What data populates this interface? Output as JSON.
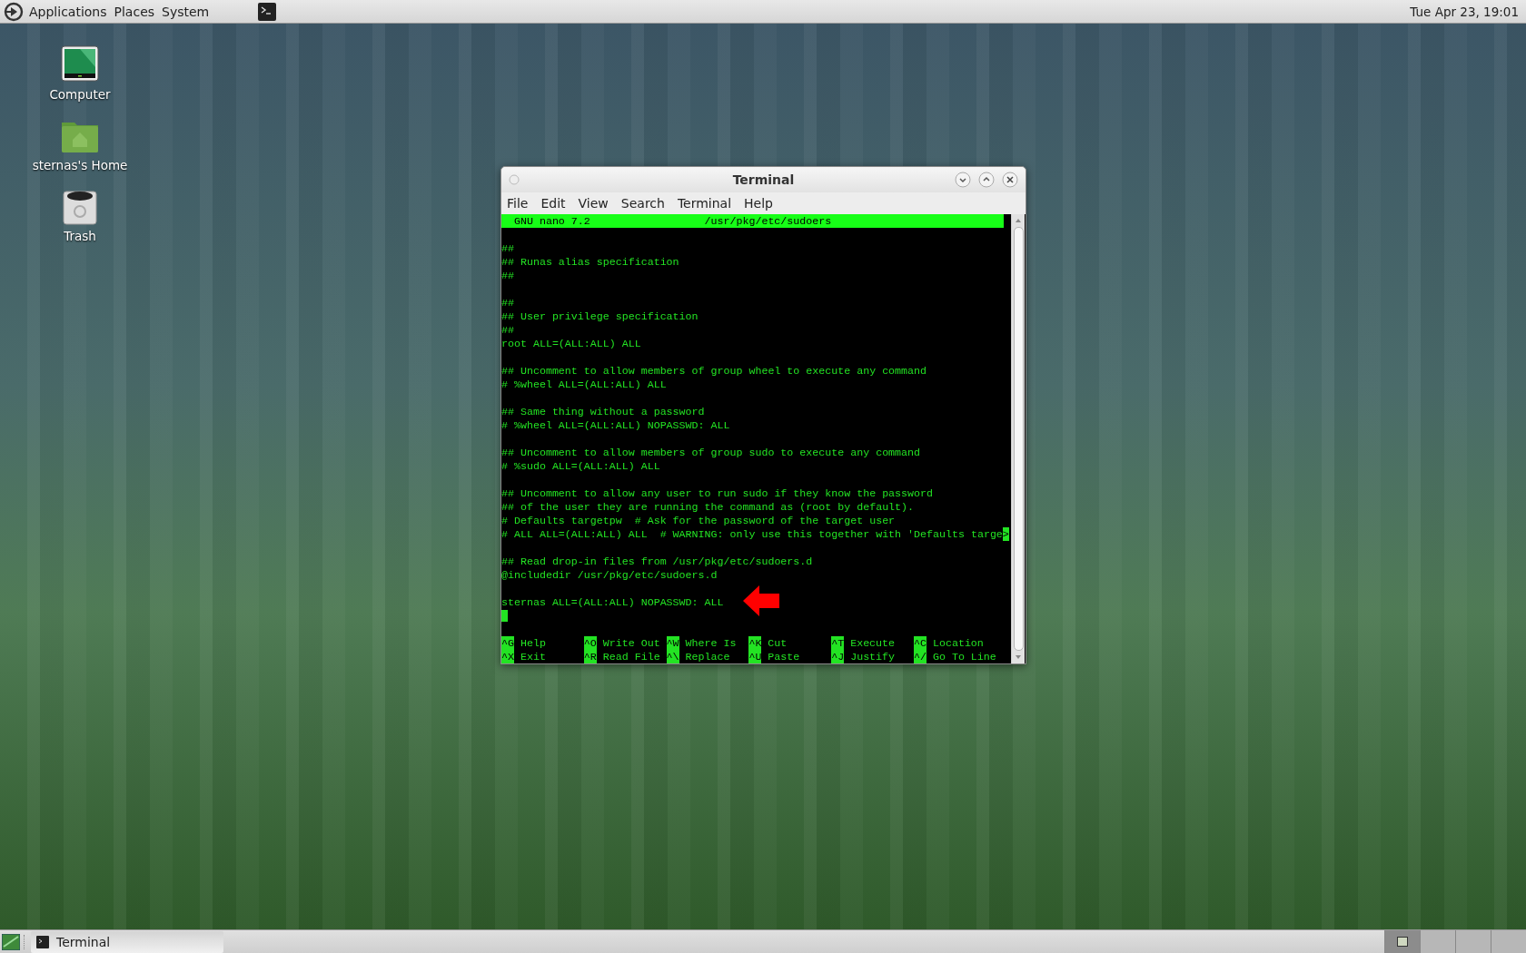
{
  "top_panel": {
    "menus": [
      "Applications",
      "Places",
      "System"
    ],
    "clock": "Tue Apr 23, 19:01"
  },
  "desktop_icons": [
    {
      "kind": "computer",
      "label": "Computer"
    },
    {
      "kind": "home",
      "label": "sternas's Home"
    },
    {
      "kind": "trash",
      "label": "Trash"
    }
  ],
  "window": {
    "title": "Terminal",
    "menu": [
      "File",
      "Edit",
      "View",
      "Search",
      "Terminal",
      "Help"
    ],
    "nano": {
      "version": "GNU nano 7.2",
      "file": "/usr/pkg/etc/sudoers",
      "lines": [
        {
          "kind": "blank"
        },
        {
          "kind": "text",
          "text": "##"
        },
        {
          "kind": "text",
          "text": "## Runas alias specification"
        },
        {
          "kind": "text",
          "text": "##"
        },
        {
          "kind": "blank"
        },
        {
          "kind": "text",
          "text": "##"
        },
        {
          "kind": "text",
          "text": "## User privilege specification"
        },
        {
          "kind": "text",
          "text": "##"
        },
        {
          "kind": "text",
          "text": "root ALL=(ALL:ALL) ALL"
        },
        {
          "kind": "blank"
        },
        {
          "kind": "text",
          "text": "## Uncomment to allow members of group wheel to execute any command"
        },
        {
          "kind": "text",
          "text": "# %wheel ALL=(ALL:ALL) ALL"
        },
        {
          "kind": "blank"
        },
        {
          "kind": "text",
          "text": "## Same thing without a password"
        },
        {
          "kind": "text",
          "text": "# %wheel ALL=(ALL:ALL) NOPASSWD: ALL"
        },
        {
          "kind": "blank"
        },
        {
          "kind": "text",
          "text": "## Uncomment to allow members of group sudo to execute any command"
        },
        {
          "kind": "text",
          "text": "# %sudo ALL=(ALL:ALL) ALL"
        },
        {
          "kind": "blank"
        },
        {
          "kind": "text",
          "text": "## Uncomment to allow any user to run sudo if they know the password"
        },
        {
          "kind": "text",
          "text": "## of the user they are running the command as (root by default)."
        },
        {
          "kind": "text",
          "text": "# Defaults targetpw  # Ask for the password of the target user"
        },
        {
          "kind": "text",
          "text": "# ALL ALL=(ALL:ALL) ALL  # WARNING: only use this together with 'Defaults targe",
          "overflow_mark": ">"
        },
        {
          "kind": "blank"
        },
        {
          "kind": "text",
          "text": "## Read drop-in files from /usr/pkg/etc/sudoers.d"
        },
        {
          "kind": "text",
          "text": "@includedir /usr/pkg/etc/sudoers.d"
        },
        {
          "kind": "blank"
        },
        {
          "kind": "text",
          "text": "sternas ALL=(ALL:ALL) NOPASSWD: ALL",
          "arrow": true
        },
        {
          "kind": "cursor"
        },
        {
          "kind": "blank"
        }
      ],
      "shortcuts": [
        [
          {
            "key": "^G",
            "label": "Help"
          },
          {
            "key": "^O",
            "label": "Write Out"
          },
          {
            "key": "^W",
            "label": "Where Is"
          },
          {
            "key": "^K",
            "label": "Cut"
          },
          {
            "key": "^T",
            "label": "Execute"
          },
          {
            "key": "^C",
            "label": "Location"
          }
        ],
        [
          {
            "key": "^X",
            "label": "Exit"
          },
          {
            "key": "^R",
            "label": "Read File"
          },
          {
            "key": "^\\",
            "label": "Replace"
          },
          {
            "key": "^U",
            "label": "Paste"
          },
          {
            "key": "^J",
            "label": "Justify"
          },
          {
            "key": "^/",
            "label": "Go To Line"
          }
        ]
      ]
    }
  },
  "taskbar": {
    "tasks": [
      {
        "label": "Terminal"
      }
    ],
    "workspaces": [
      {
        "selected": true
      },
      {
        "selected": false
      },
      {
        "selected": false
      },
      {
        "selected": false
      }
    ]
  }
}
